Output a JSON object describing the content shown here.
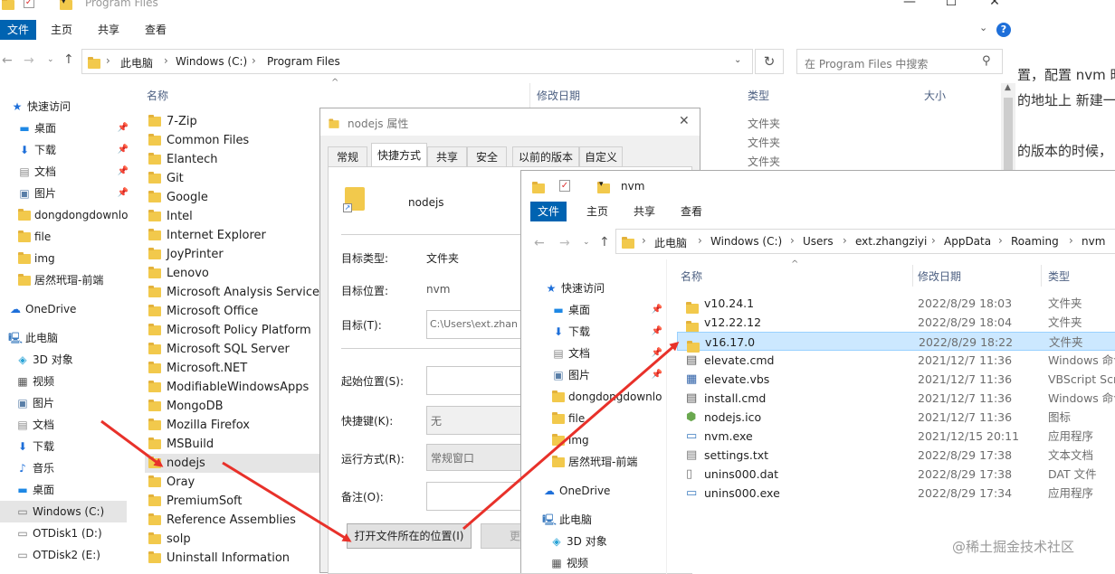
{
  "back_window": {
    "title": "Program Files",
    "ribbon_tabs": [
      "文件",
      "主页",
      "共享",
      "查看"
    ],
    "crumbs": [
      "此电脑",
      "Windows (C:)",
      "Program Files"
    ],
    "search_placeholder": "在 Program Files 中搜索",
    "columns": {
      "name": "名称",
      "date": "修改日期",
      "type": "类型",
      "size": "大小"
    },
    "types": [
      "文件夹",
      "文件夹",
      "文件夹"
    ],
    "folders": [
      "7-Zip",
      "Common Files",
      "Elantech",
      "Git",
      "Google",
      "Intel",
      "Internet Explorer",
      "JoyPrinter",
      "Lenovo",
      "Microsoft Analysis Services",
      "Microsoft Office",
      "Microsoft Policy Platform",
      "Microsoft SQL Server",
      "Microsoft.NET",
      "ModifiableWindowsApps",
      "MongoDB",
      "Mozilla Firefox",
      "MSBuild",
      "nodejs",
      "Oray",
      "PremiumSoft",
      "Reference Assemblies",
      "solp",
      "Uninstall Information"
    ],
    "quick_access": "快速访问",
    "quick_items": [
      "桌面",
      "下载",
      "文档",
      "图片",
      "dongdongdownlo",
      "file",
      "img",
      "居然玳瑁-前端"
    ],
    "onedrive": "OneDrive",
    "this_pc": "此电脑",
    "pc_items": [
      "3D 对象",
      "视频",
      "图片",
      "文档",
      "下载",
      "音乐",
      "桌面",
      "Windows (C:)",
      "OTDisk1 (D:)",
      "OTDisk2 (E:)"
    ]
  },
  "bg_text": {
    "line1": "置，配置 nvm 时",
    "line2": "的地址上 新建一",
    "line3": "的版本的时候，"
  },
  "props": {
    "title": "nodejs 属性",
    "tabs": [
      "常规",
      "快捷方式",
      "共享",
      "安全",
      "以前的版本",
      "自定义"
    ],
    "name": "nodejs",
    "target_type_label": "目标类型:",
    "target_type": "文件夹",
    "target_loc_label": "目标位置:",
    "target_loc": "nvm",
    "target_label": "目标(T):",
    "target_value": "C:\\Users\\ext.zhan",
    "start_label": "起始位置(S):",
    "hotkey_label": "快捷键(K):",
    "hotkey_value": "无",
    "run_label": "运行方式(R):",
    "run_value": "常规窗口",
    "comment_label": "备注(O):",
    "open_btn": "打开文件所在的位置(I)",
    "change_btn": "更改图"
  },
  "nvm_window": {
    "title": "nvm",
    "ribbon_tabs": [
      "文件",
      "主页",
      "共享",
      "查看"
    ],
    "crumbs": [
      "此电脑",
      "Windows (C:)",
      "Users",
      "ext.zhangziyi",
      "AppData",
      "Roaming",
      "nvm"
    ],
    "columns": {
      "name": "名称",
      "date": "修改日期",
      "type": "类型"
    },
    "files": [
      {
        "name": "v10.24.1",
        "date": "2022/8/29 18:03",
        "type": "文件夹",
        "icon": "folder"
      },
      {
        "name": "v12.22.12",
        "date": "2022/8/29 18:04",
        "type": "文件夹",
        "icon": "folder"
      },
      {
        "name": "v16.17.0",
        "date": "2022/8/29 18:22",
        "type": "文件夹",
        "icon": "folder"
      },
      {
        "name": "elevate.cmd",
        "date": "2021/12/7 11:36",
        "type": "Windows 命令",
        "icon": "cmd"
      },
      {
        "name": "elevate.vbs",
        "date": "2021/12/7 11:36",
        "type": "VBScript Scri",
        "icon": "vbs"
      },
      {
        "name": "install.cmd",
        "date": "2021/12/7 11:36",
        "type": "Windows 命令",
        "icon": "cmd"
      },
      {
        "name": "nodejs.ico",
        "date": "2021/12/7 11:36",
        "type": "图标",
        "icon": "ico"
      },
      {
        "name": "nvm.exe",
        "date": "2021/12/15 20:11",
        "type": "应用程序",
        "icon": "exe"
      },
      {
        "name": "settings.txt",
        "date": "2022/8/29 17:38",
        "type": "文本文档",
        "icon": "txt"
      },
      {
        "name": "unins000.dat",
        "date": "2022/8/29 17:38",
        "type": "DAT 文件",
        "icon": "dat"
      },
      {
        "name": "unins000.exe",
        "date": "2022/8/29 17:34",
        "type": "应用程序",
        "icon": "exe"
      }
    ],
    "quick_access": "快速访问",
    "quick_items": [
      "桌面",
      "下载",
      "文档",
      "图片",
      "dongdongdownlo",
      "file",
      "img",
      "居然玳瑁-前端"
    ],
    "onedrive": "OneDrive",
    "this_pc": "此电脑",
    "pc_items": [
      "3D 对象",
      "视频"
    ]
  },
  "watermark": "@稀土掘金技术社区",
  "colors": {
    "accent": "#0063b1",
    "selection": "#cce8ff",
    "arrow": "#e8312a",
    "folder": "#f2c94c"
  }
}
